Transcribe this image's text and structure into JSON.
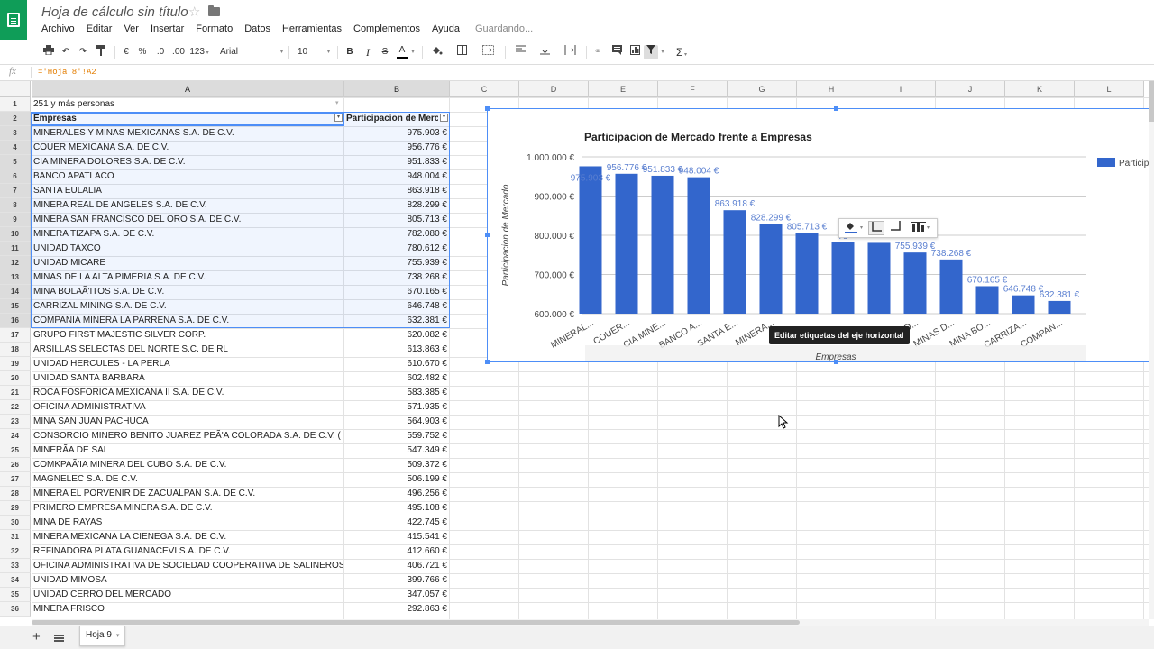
{
  "app": {
    "doc_title": "Hoja de cálculo sin título",
    "status": "Guardando..."
  },
  "menubar": {
    "items": [
      "Archivo",
      "Editar",
      "Ver",
      "Insertar",
      "Formato",
      "Datos",
      "Herramientas",
      "Complementos",
      "Ayuda"
    ]
  },
  "toolbar": {
    "currency": "€",
    "percent": "%",
    "decrease_decimals": ".0",
    "increase_decimals": ".00",
    "more_formats": "123",
    "font": "Arial",
    "font_size": "10",
    "bold": "B",
    "italic": "I",
    "strike": "S",
    "text_color": "A",
    "functions": "Σ"
  },
  "formula_bar": {
    "fx": "fx",
    "content": "='Hoja 8'!A2"
  },
  "grid": {
    "columns": [
      "A",
      "B",
      "C",
      "D",
      "E",
      "F",
      "G",
      "H",
      "I",
      "J",
      "K",
      "L"
    ],
    "rows": [
      {
        "n": "1",
        "a": "251 y más personas",
        "b": ""
      },
      {
        "n": "2",
        "a": "Empresas",
        "b": "Participacion de Merc"
      },
      {
        "n": "3",
        "a": "MINERALES Y MINAS MEXICANAS S.A. DE C.V.",
        "b": "975.903 €"
      },
      {
        "n": "4",
        "a": "COUER MEXICANA S.A. DE C.V.",
        "b": "956.776 €"
      },
      {
        "n": "5",
        "a": "CIA MINERA DOLORES S.A. DE C.V.",
        "b": "951.833 €"
      },
      {
        "n": "6",
        "a": "BANCO APATLACO",
        "b": "948.004 €"
      },
      {
        "n": "7",
        "a": "SANTA EULALIA",
        "b": "863.918 €"
      },
      {
        "n": "8",
        "a": "MINERA REAL DE ANGELES S.A. DE C.V.",
        "b": "828.299 €"
      },
      {
        "n": "9",
        "a": "MINERA SAN FRANCISCO DEL ORO S.A. DE C.V.",
        "b": "805.713 €"
      },
      {
        "n": "10",
        "a": "MINERA TIZAPA S.A. DE C.V.",
        "b": "782.080 €"
      },
      {
        "n": "11",
        "a": "UNIDAD TAXCO",
        "b": "780.612 €"
      },
      {
        "n": "12",
        "a": "UNIDAD MICARE",
        "b": "755.939 €"
      },
      {
        "n": "13",
        "a": "MINAS DE LA ALTA PIMERIA S.A. DE C.V.",
        "b": "738.268 €"
      },
      {
        "n": "14",
        "a": "MINA BOLAÃ'ITOS S.A. DE C.V.",
        "b": "670.165 €"
      },
      {
        "n": "15",
        "a": "CARRIZAL MINING S.A. DE C.V.",
        "b": "646.748 €"
      },
      {
        "n": "16",
        "a": "COMPANIA MINERA LA PARRENA S.A. DE C.V.",
        "b": "632.381 €"
      },
      {
        "n": "17",
        "a": "GRUPO FIRST MAJESTIC SILVER CORP.",
        "b": "620.082 €"
      },
      {
        "n": "18",
        "a": "ARSILLAS SELECTAS DEL NORTE S.C. DE RL",
        "b": "613.863 €"
      },
      {
        "n": "19",
        "a": "UNIDAD HERCULES - LA PERLA",
        "b": "610.670 €"
      },
      {
        "n": "20",
        "a": "UNIDAD SANTA BARBARA",
        "b": "602.482 €"
      },
      {
        "n": "21",
        "a": "ROCA FOSFORICA MEXICANA II S.A. DE C.V.",
        "b": "583.385 €"
      },
      {
        "n": "22",
        "a": "OFICINA ADMINISTRATIVA",
        "b": "571.935 €"
      },
      {
        "n": "23",
        "a": "MINA SAN JUAN PACHUCA",
        "b": "564.903 €"
      },
      {
        "n": "24",
        "a": "CONSORCIO MINERO BENITO JUAREZ PEÃ'A COLORADA S.A. DE C.V. (",
        "b": "559.752 €"
      },
      {
        "n": "25",
        "a": "MINERÃA DE SAL",
        "b": "547.349 €"
      },
      {
        "n": "26",
        "a": "COMKPAÃ'IA MINERA DEL CUBO S.A. DE C.V.",
        "b": "509.372 €"
      },
      {
        "n": "27",
        "a": "MAGNELEC S.A. DE C.V.",
        "b": "506.199 €"
      },
      {
        "n": "28",
        "a": "MINERA EL PORVENIR DE ZACUALPAN S.A. DE C.V.",
        "b": "496.256 €"
      },
      {
        "n": "29",
        "a": "PRIMERO EMPRESA MINERA S.A. DE C.V.",
        "b": "495.108 €"
      },
      {
        "n": "30",
        "a": "MINA DE RAYAS",
        "b": "422.745 €"
      },
      {
        "n": "31",
        "a": "MINERA MEXICANA LA CIENEGA S.A. DE C.V.",
        "b": "415.541 €"
      },
      {
        "n": "32",
        "a": "REFINADORA PLATA GUANACEVI S.A. DE C.V.",
        "b": "412.660 €"
      },
      {
        "n": "33",
        "a": "OFICINA ADMINISTRATIVA DE SOCIEDAD COOPERATIVA DE SALINEROS",
        "b": "406.721 €"
      },
      {
        "n": "34",
        "a": "UNIDAD MIMOSA",
        "b": "399.766 €"
      },
      {
        "n": "35",
        "a": "UNIDAD CERRO DEL MERCADO",
        "b": "347.057 €"
      },
      {
        "n": "36",
        "a": "MINERA FRISCO",
        "b": "292.863 €"
      }
    ]
  },
  "chart_data": {
    "type": "bar",
    "title": "Participacion de Mercado frente a Empresas",
    "xlabel": "Empresas",
    "ylabel": "Participacion de Mercado",
    "legend": "Particip",
    "legend_position": "right",
    "categories": [
      "MINERAL...",
      "COUER...",
      "CIA MINE...",
      "BANCO A...",
      "SANTA E...",
      "MINERA...",
      "",
      "",
      "",
      "...DAD...",
      "MINAS D...",
      "MINA BO...",
      "CARRIZA...",
      "COMPAN..."
    ],
    "values": [
      975903,
      956776,
      951833,
      948004,
      863918,
      828299,
      805713,
      782080,
      780612,
      755939,
      738268,
      670165,
      646748,
      632381
    ],
    "data_labels": [
      "975.903 €",
      "956.776 €",
      "951.833 €",
      "948.004 €",
      "863.918 €",
      "828.299 €",
      "805.713 €",
      "78",
      "",
      "755.939 €",
      "738.268 €",
      "670.165 €",
      "646.748 €",
      "632.381 €"
    ],
    "ylim": [
      600000,
      1000000
    ],
    "yticks": [
      600000,
      700000,
      800000,
      900000,
      1000000
    ],
    "ytick_labels": [
      "600.000 €",
      "700.000 €",
      "800.000 €",
      "900.000 €",
      "1.000.000 €"
    ],
    "grid": true,
    "color": "#3366cc"
  },
  "tooltip": "Editar etiquetas del eje horizontal",
  "sheet_tab": "Hoja 9"
}
